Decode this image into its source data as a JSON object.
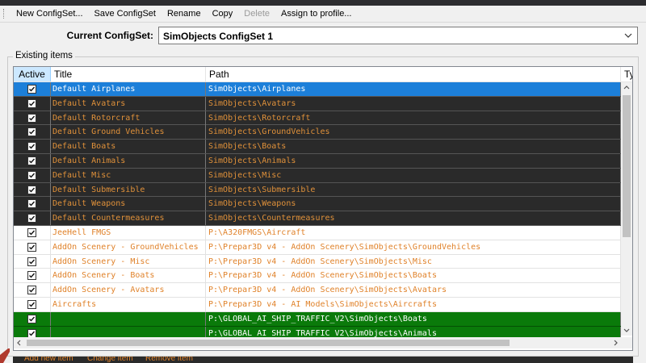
{
  "toolbar": {
    "items": [
      {
        "label": "New ConfigSet...",
        "enabled": true
      },
      {
        "label": "Save ConfigSet",
        "enabled": true
      },
      {
        "label": "Rename",
        "enabled": true
      },
      {
        "label": "Copy",
        "enabled": true
      },
      {
        "label": "Delete",
        "enabled": false
      },
      {
        "label": "Assign to profile...",
        "enabled": true
      }
    ]
  },
  "configset": {
    "label": "Current ConfigSet:",
    "selected": "SimObjects ConfigSet 1"
  },
  "group": {
    "title": "Existing items"
  },
  "table": {
    "headers": {
      "active": "Active",
      "title": "Title",
      "path": "Path",
      "type": "Ty"
    },
    "rows": [
      {
        "active": true,
        "title": "Default Airplanes",
        "path": "SimObjects\\Airplanes",
        "style": "sel"
      },
      {
        "active": true,
        "title": "Default Avatars",
        "path": "SimObjects\\Avatars",
        "style": "dark"
      },
      {
        "active": true,
        "title": "Default Rotorcraft",
        "path": "SimObjects\\Rotorcraft",
        "style": "dark"
      },
      {
        "active": true,
        "title": "Default Ground Vehicles",
        "path": "SimObjects\\GroundVehicles",
        "style": "dark"
      },
      {
        "active": true,
        "title": "Default Boats",
        "path": "SimObjects\\Boats",
        "style": "dark"
      },
      {
        "active": true,
        "title": "Default Animals",
        "path": "SimObjects\\Animals",
        "style": "dark"
      },
      {
        "active": true,
        "title": "Default Misc",
        "path": "SimObjects\\Misc",
        "style": "dark"
      },
      {
        "active": true,
        "title": "Default Submersible",
        "path": "SimObjects\\Submersible",
        "style": "dark"
      },
      {
        "active": true,
        "title": "Default Weapons",
        "path": "SimObjects\\Weapons",
        "style": "dark"
      },
      {
        "active": true,
        "title": "Default Countermeasures",
        "path": "SimObjects\\Countermeasures",
        "style": "dark"
      },
      {
        "active": true,
        "title": "JeeHell FMGS",
        "path": "P:\\A320FMGS\\Aircraft",
        "style": "light"
      },
      {
        "active": true,
        "title": "AddOn Scenery - GroundVehicles",
        "path": "P:\\Prepar3D v4 - AddOn Scenery\\SimObjects\\GroundVehicles",
        "style": "light"
      },
      {
        "active": true,
        "title": "AddOn Scenery - Misc",
        "path": "P:\\Prepar3D v4 - AddOn Scenery\\SimObjects\\Misc",
        "style": "light"
      },
      {
        "active": true,
        "title": "AddOn Scenery - Boats",
        "path": "P:\\Prepar3D v4 - AddOn Scenery\\SimObjects\\Boats",
        "style": "light"
      },
      {
        "active": true,
        "title": "AddOn Scenery - Avatars",
        "path": "P:\\Prepar3D v4 - AddOn Scenery\\SimObjects\\Avatars",
        "style": "light"
      },
      {
        "active": true,
        "title": "Aircrafts",
        "path": "P:\\Prepar3D v4 - AI Models\\SimObjects\\Aircrafts",
        "style": "light"
      },
      {
        "active": true,
        "title": "",
        "path": "P:\\GLOBAL_AI_SHIP_TRAFFIC_V2\\SimObjects\\Boats",
        "style": "green"
      },
      {
        "active": true,
        "title": "",
        "path": "P:\\GLOBAL_AI_SHIP_TRAFFIC_V2\\SimObjects\\Animals",
        "style": "green"
      }
    ]
  },
  "bottom_actions": [
    "Add new item",
    "Change item",
    "Remove item"
  ],
  "colors": {
    "selection": "#1c7fd9",
    "dark_row": "#2a2a2a",
    "row_text_orange": "#e0913a",
    "green_row": "#0a7a0a",
    "header_active": "#cce8ff"
  }
}
